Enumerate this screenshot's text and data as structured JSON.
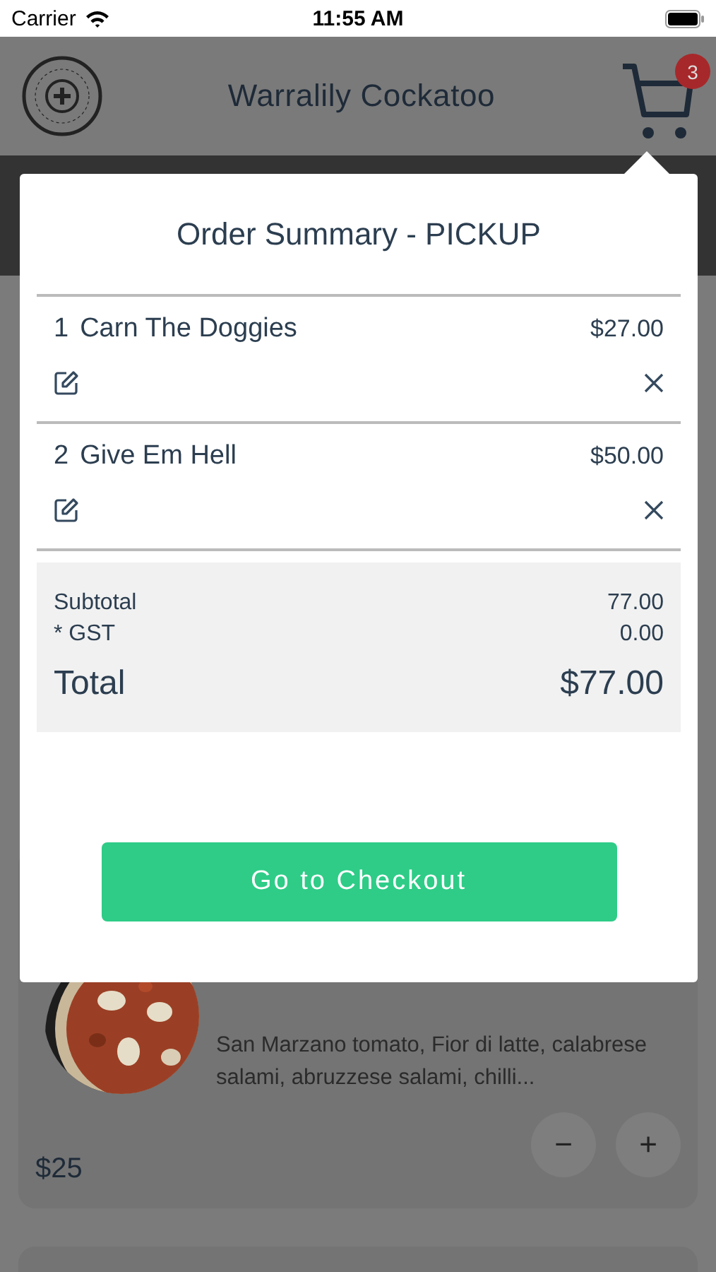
{
  "status_bar": {
    "carrier": "Carrier",
    "time": "11:55 AM"
  },
  "header": {
    "title": "Warralily Cockatoo",
    "cart_count": "3"
  },
  "order_summary": {
    "title": "Order Summary - PICKUP",
    "items": [
      {
        "qty": "1",
        "name": "Carn The Doggies",
        "price": "$27.00"
      },
      {
        "qty": "2",
        "name": "Give Em Hell",
        "price": "$50.00"
      }
    ],
    "subtotal_label": "Subtotal",
    "subtotal": "77.00",
    "gst_label": "* GST",
    "gst": "0.00",
    "total_label": "Total",
    "total": "$77.00",
    "checkout_button": "Go to Checkout"
  },
  "menu_item": {
    "description": "San Marzano tomato, Fior di latte, calabrese salami, abruzzese salami, chilli...",
    "price": "$25",
    "decrement": "−",
    "increment": "+"
  }
}
